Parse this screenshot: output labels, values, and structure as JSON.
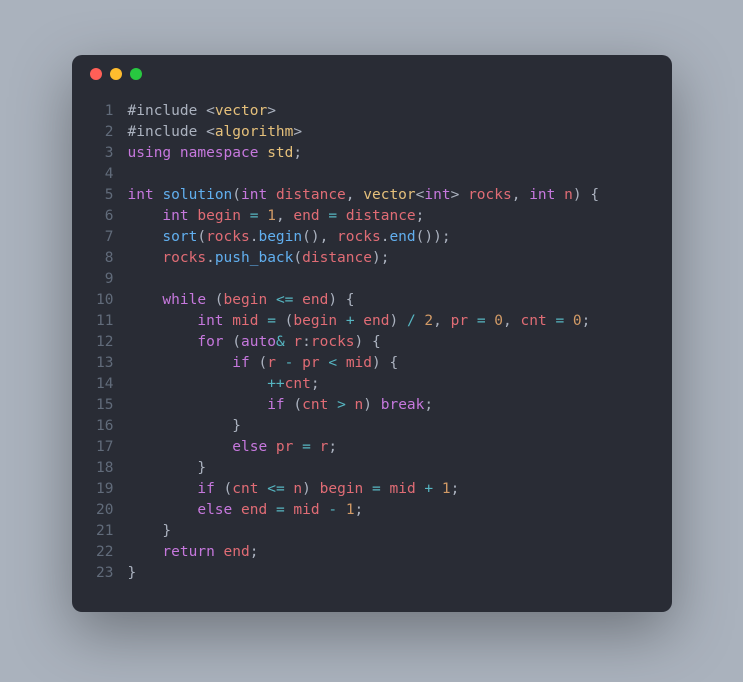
{
  "lines": [
    {
      "n": "1",
      "t": [
        {
          "c": "pp",
          "s": "#include"
        },
        {
          "c": "pn",
          "s": " <"
        },
        {
          "c": "id",
          "s": "vector"
        },
        {
          "c": "pn",
          "s": ">"
        }
      ]
    },
    {
      "n": "2",
      "t": [
        {
          "c": "pp",
          "s": "#include"
        },
        {
          "c": "pn",
          "s": " <"
        },
        {
          "c": "id",
          "s": "algorithm"
        },
        {
          "c": "pn",
          "s": ">"
        }
      ]
    },
    {
      "n": "3",
      "t": [
        {
          "c": "kw",
          "s": "using"
        },
        {
          "c": "pn",
          "s": " "
        },
        {
          "c": "kw",
          "s": "namespace"
        },
        {
          "c": "pn",
          "s": " "
        },
        {
          "c": "id",
          "s": "std"
        },
        {
          "c": "pn",
          "s": ";"
        }
      ]
    },
    {
      "n": "4",
      "t": []
    },
    {
      "n": "5",
      "t": [
        {
          "c": "ty",
          "s": "int"
        },
        {
          "c": "pn",
          "s": " "
        },
        {
          "c": "fn",
          "s": "solution"
        },
        {
          "c": "pn",
          "s": "("
        },
        {
          "c": "ty",
          "s": "int"
        },
        {
          "c": "pn",
          "s": " "
        },
        {
          "c": "var",
          "s": "distance"
        },
        {
          "c": "pn",
          "s": ", "
        },
        {
          "c": "id",
          "s": "vector"
        },
        {
          "c": "pn",
          "s": "<"
        },
        {
          "c": "ty",
          "s": "int"
        },
        {
          "c": "pn",
          "s": "> "
        },
        {
          "c": "var",
          "s": "rocks"
        },
        {
          "c": "pn",
          "s": ", "
        },
        {
          "c": "ty",
          "s": "int"
        },
        {
          "c": "pn",
          "s": " "
        },
        {
          "c": "var",
          "s": "n"
        },
        {
          "c": "pn",
          "s": ") {"
        }
      ]
    },
    {
      "n": "6",
      "t": [
        {
          "c": "pn",
          "s": "    "
        },
        {
          "c": "ty",
          "s": "int"
        },
        {
          "c": "pn",
          "s": " "
        },
        {
          "c": "var",
          "s": "begin"
        },
        {
          "c": "pn",
          "s": " "
        },
        {
          "c": "op",
          "s": "="
        },
        {
          "c": "pn",
          "s": " "
        },
        {
          "c": "num",
          "s": "1"
        },
        {
          "c": "pn",
          "s": ", "
        },
        {
          "c": "var",
          "s": "end"
        },
        {
          "c": "pn",
          "s": " "
        },
        {
          "c": "op",
          "s": "="
        },
        {
          "c": "pn",
          "s": " "
        },
        {
          "c": "var",
          "s": "distance"
        },
        {
          "c": "pn",
          "s": ";"
        }
      ]
    },
    {
      "n": "7",
      "t": [
        {
          "c": "pn",
          "s": "    "
        },
        {
          "c": "fn",
          "s": "sort"
        },
        {
          "c": "pn",
          "s": "("
        },
        {
          "c": "var",
          "s": "rocks"
        },
        {
          "c": "pn",
          "s": "."
        },
        {
          "c": "fn",
          "s": "begin"
        },
        {
          "c": "pn",
          "s": "(), "
        },
        {
          "c": "var",
          "s": "rocks"
        },
        {
          "c": "pn",
          "s": "."
        },
        {
          "c": "fn",
          "s": "end"
        },
        {
          "c": "pn",
          "s": "());"
        }
      ]
    },
    {
      "n": "8",
      "t": [
        {
          "c": "pn",
          "s": "    "
        },
        {
          "c": "var",
          "s": "rocks"
        },
        {
          "c": "pn",
          "s": "."
        },
        {
          "c": "fn",
          "s": "push_back"
        },
        {
          "c": "pn",
          "s": "("
        },
        {
          "c": "var",
          "s": "distance"
        },
        {
          "c": "pn",
          "s": ");"
        }
      ]
    },
    {
      "n": "9",
      "t": []
    },
    {
      "n": "10",
      "t": [
        {
          "c": "pn",
          "s": "    "
        },
        {
          "c": "kw",
          "s": "while"
        },
        {
          "c": "pn",
          "s": " ("
        },
        {
          "c": "var",
          "s": "begin"
        },
        {
          "c": "pn",
          "s": " "
        },
        {
          "c": "op",
          "s": "<="
        },
        {
          "c": "pn",
          "s": " "
        },
        {
          "c": "var",
          "s": "end"
        },
        {
          "c": "pn",
          "s": ") {"
        }
      ]
    },
    {
      "n": "11",
      "t": [
        {
          "c": "pn",
          "s": "        "
        },
        {
          "c": "ty",
          "s": "int"
        },
        {
          "c": "pn",
          "s": " "
        },
        {
          "c": "var",
          "s": "mid"
        },
        {
          "c": "pn",
          "s": " "
        },
        {
          "c": "op",
          "s": "="
        },
        {
          "c": "pn",
          "s": " ("
        },
        {
          "c": "var",
          "s": "begin"
        },
        {
          "c": "pn",
          "s": " "
        },
        {
          "c": "op",
          "s": "+"
        },
        {
          "c": "pn",
          "s": " "
        },
        {
          "c": "var",
          "s": "end"
        },
        {
          "c": "pn",
          "s": ") "
        },
        {
          "c": "op",
          "s": "/"
        },
        {
          "c": "pn",
          "s": " "
        },
        {
          "c": "num",
          "s": "2"
        },
        {
          "c": "pn",
          "s": ", "
        },
        {
          "c": "var",
          "s": "pr"
        },
        {
          "c": "pn",
          "s": " "
        },
        {
          "c": "op",
          "s": "="
        },
        {
          "c": "pn",
          "s": " "
        },
        {
          "c": "num",
          "s": "0"
        },
        {
          "c": "pn",
          "s": ", "
        },
        {
          "c": "var",
          "s": "cnt"
        },
        {
          "c": "pn",
          "s": " "
        },
        {
          "c": "op",
          "s": "="
        },
        {
          "c": "pn",
          "s": " "
        },
        {
          "c": "num",
          "s": "0"
        },
        {
          "c": "pn",
          "s": ";"
        }
      ]
    },
    {
      "n": "12",
      "t": [
        {
          "c": "pn",
          "s": "        "
        },
        {
          "c": "kw",
          "s": "for"
        },
        {
          "c": "pn",
          "s": " ("
        },
        {
          "c": "ty",
          "s": "auto"
        },
        {
          "c": "op",
          "s": "&"
        },
        {
          "c": "pn",
          "s": " "
        },
        {
          "c": "var",
          "s": "r"
        },
        {
          "c": "pn",
          "s": ":"
        },
        {
          "c": "var",
          "s": "rocks"
        },
        {
          "c": "pn",
          "s": ") {"
        }
      ]
    },
    {
      "n": "13",
      "t": [
        {
          "c": "pn",
          "s": "            "
        },
        {
          "c": "kw",
          "s": "if"
        },
        {
          "c": "pn",
          "s": " ("
        },
        {
          "c": "var",
          "s": "r"
        },
        {
          "c": "pn",
          "s": " "
        },
        {
          "c": "op",
          "s": "-"
        },
        {
          "c": "pn",
          "s": " "
        },
        {
          "c": "var",
          "s": "pr"
        },
        {
          "c": "pn",
          "s": " "
        },
        {
          "c": "op",
          "s": "<"
        },
        {
          "c": "pn",
          "s": " "
        },
        {
          "c": "var",
          "s": "mid"
        },
        {
          "c": "pn",
          "s": ") {"
        }
      ]
    },
    {
      "n": "14",
      "t": [
        {
          "c": "pn",
          "s": "                "
        },
        {
          "c": "op",
          "s": "++"
        },
        {
          "c": "var",
          "s": "cnt"
        },
        {
          "c": "pn",
          "s": ";"
        }
      ]
    },
    {
      "n": "15",
      "t": [
        {
          "c": "pn",
          "s": "                "
        },
        {
          "c": "kw",
          "s": "if"
        },
        {
          "c": "pn",
          "s": " ("
        },
        {
          "c": "var",
          "s": "cnt"
        },
        {
          "c": "pn",
          "s": " "
        },
        {
          "c": "op",
          "s": ">"
        },
        {
          "c": "pn",
          "s": " "
        },
        {
          "c": "var",
          "s": "n"
        },
        {
          "c": "pn",
          "s": ") "
        },
        {
          "c": "kw",
          "s": "break"
        },
        {
          "c": "pn",
          "s": ";"
        }
      ]
    },
    {
      "n": "16",
      "t": [
        {
          "c": "pn",
          "s": "            }"
        }
      ]
    },
    {
      "n": "17",
      "t": [
        {
          "c": "pn",
          "s": "            "
        },
        {
          "c": "kw",
          "s": "else"
        },
        {
          "c": "pn",
          "s": " "
        },
        {
          "c": "var",
          "s": "pr"
        },
        {
          "c": "pn",
          "s": " "
        },
        {
          "c": "op",
          "s": "="
        },
        {
          "c": "pn",
          "s": " "
        },
        {
          "c": "var",
          "s": "r"
        },
        {
          "c": "pn",
          "s": ";"
        }
      ]
    },
    {
      "n": "18",
      "t": [
        {
          "c": "pn",
          "s": "        }"
        }
      ]
    },
    {
      "n": "19",
      "t": [
        {
          "c": "pn",
          "s": "        "
        },
        {
          "c": "kw",
          "s": "if"
        },
        {
          "c": "pn",
          "s": " ("
        },
        {
          "c": "var",
          "s": "cnt"
        },
        {
          "c": "pn",
          "s": " "
        },
        {
          "c": "op",
          "s": "<="
        },
        {
          "c": "pn",
          "s": " "
        },
        {
          "c": "var",
          "s": "n"
        },
        {
          "c": "pn",
          "s": ") "
        },
        {
          "c": "var",
          "s": "begin"
        },
        {
          "c": "pn",
          "s": " "
        },
        {
          "c": "op",
          "s": "="
        },
        {
          "c": "pn",
          "s": " "
        },
        {
          "c": "var",
          "s": "mid"
        },
        {
          "c": "pn",
          "s": " "
        },
        {
          "c": "op",
          "s": "+"
        },
        {
          "c": "pn",
          "s": " "
        },
        {
          "c": "num",
          "s": "1"
        },
        {
          "c": "pn",
          "s": ";"
        }
      ]
    },
    {
      "n": "20",
      "t": [
        {
          "c": "pn",
          "s": "        "
        },
        {
          "c": "kw",
          "s": "else"
        },
        {
          "c": "pn",
          "s": " "
        },
        {
          "c": "var",
          "s": "end"
        },
        {
          "c": "pn",
          "s": " "
        },
        {
          "c": "op",
          "s": "="
        },
        {
          "c": "pn",
          "s": " "
        },
        {
          "c": "var",
          "s": "mid"
        },
        {
          "c": "pn",
          "s": " "
        },
        {
          "c": "op",
          "s": "-"
        },
        {
          "c": "pn",
          "s": " "
        },
        {
          "c": "num",
          "s": "1"
        },
        {
          "c": "pn",
          "s": ";"
        }
      ]
    },
    {
      "n": "21",
      "t": [
        {
          "c": "pn",
          "s": "    }"
        }
      ]
    },
    {
      "n": "22",
      "t": [
        {
          "c": "pn",
          "s": "    "
        },
        {
          "c": "kw",
          "s": "return"
        },
        {
          "c": "pn",
          "s": " "
        },
        {
          "c": "var",
          "s": "end"
        },
        {
          "c": "pn",
          "s": ";"
        }
      ]
    },
    {
      "n": "23",
      "t": [
        {
          "c": "pn",
          "s": "}"
        }
      ]
    }
  ]
}
